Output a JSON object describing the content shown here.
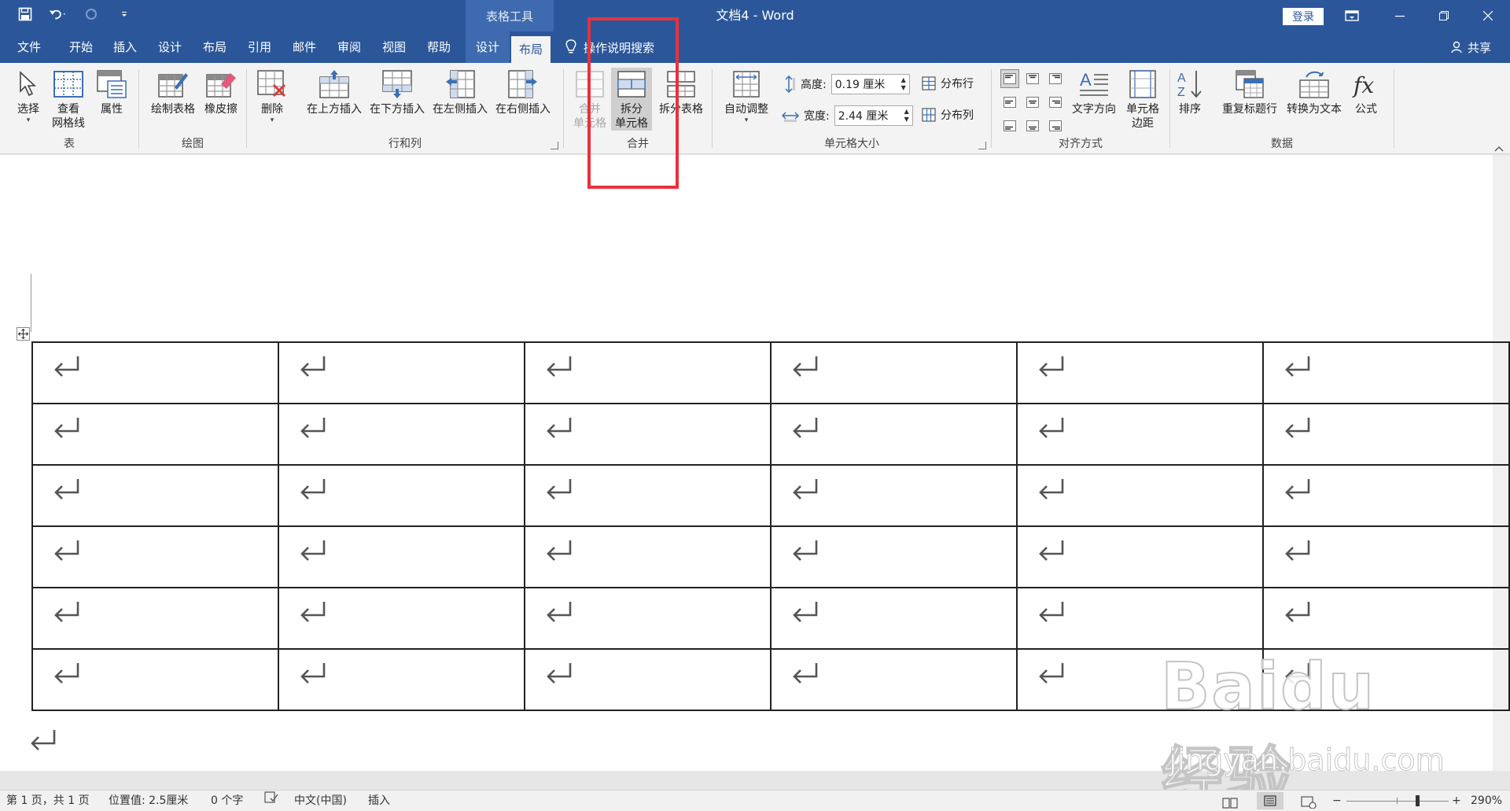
{
  "titlebar": {
    "context_header": "表格工具",
    "doc_name": "文档4",
    "separator": "-",
    "app_name": "Word",
    "signin": "登录"
  },
  "tabs": [
    {
      "label": "文件"
    },
    {
      "label": "开始"
    },
    {
      "label": "插入"
    },
    {
      "label": "设计"
    },
    {
      "label": "布局"
    },
    {
      "label": "引用"
    },
    {
      "label": "邮件"
    },
    {
      "label": "审阅"
    },
    {
      "label": "视图"
    },
    {
      "label": "帮助"
    }
  ],
  "context_tabs": [
    {
      "label": "设计"
    },
    {
      "label": "布局"
    }
  ],
  "tellme": "操作说明搜索",
  "share": "共享",
  "ribbon": {
    "table_group": {
      "label": "表",
      "select": "选择",
      "gridlines_1": "查看",
      "gridlines_2": "网格线",
      "properties": "属性"
    },
    "draw_group": {
      "label": "绘图",
      "draw_table": "绘制表格",
      "eraser": "橡皮擦"
    },
    "rowscols_group": {
      "label": "行和列",
      "delete": "删除",
      "insert_above": "在上方插入",
      "insert_below": "在下方插入",
      "insert_left": "在左侧插入",
      "insert_right": "在右侧插入"
    },
    "merge_group": {
      "label": "合并",
      "merge_1": "合并",
      "merge_2": "单元格",
      "split_1": "拆分",
      "split_2": "单元格",
      "split_table": "拆分表格"
    },
    "size_group": {
      "label": "单元格大小",
      "autofit": "自动调整",
      "height_label": "高度:",
      "height_value": "0.19 厘米",
      "width_label": "宽度:",
      "width_value": "2.44 厘米",
      "dist_rows": "分布行",
      "dist_cols": "分布列"
    },
    "align_group": {
      "label": "对齐方式",
      "text_dir": "文字方向",
      "margins_1": "单元格",
      "margins_2": "边距"
    },
    "data_group": {
      "label": "数据",
      "sort": "排序",
      "repeat_header": "重复标题行",
      "to_text": "转换为文本",
      "formula": "公式"
    }
  },
  "document": {
    "rows": 6,
    "cols": 6
  },
  "statusbar": {
    "page": "第 1 页，共 1 页",
    "position": "位置值: 2.5厘米",
    "words": "0 个字",
    "language": "中文(中国)",
    "mode": "插入",
    "zoom_minus": "−",
    "zoom_plus": "+",
    "zoom": "290%"
  },
  "watermark": {
    "logo": "Baidu经验",
    "url": "jingyan.baidu.com"
  },
  "colors": {
    "title_bar": "#2b579a",
    "context_tab": "#3e6bb0",
    "ribbon": "#f3f3f3",
    "highlight": "#e8313c"
  }
}
